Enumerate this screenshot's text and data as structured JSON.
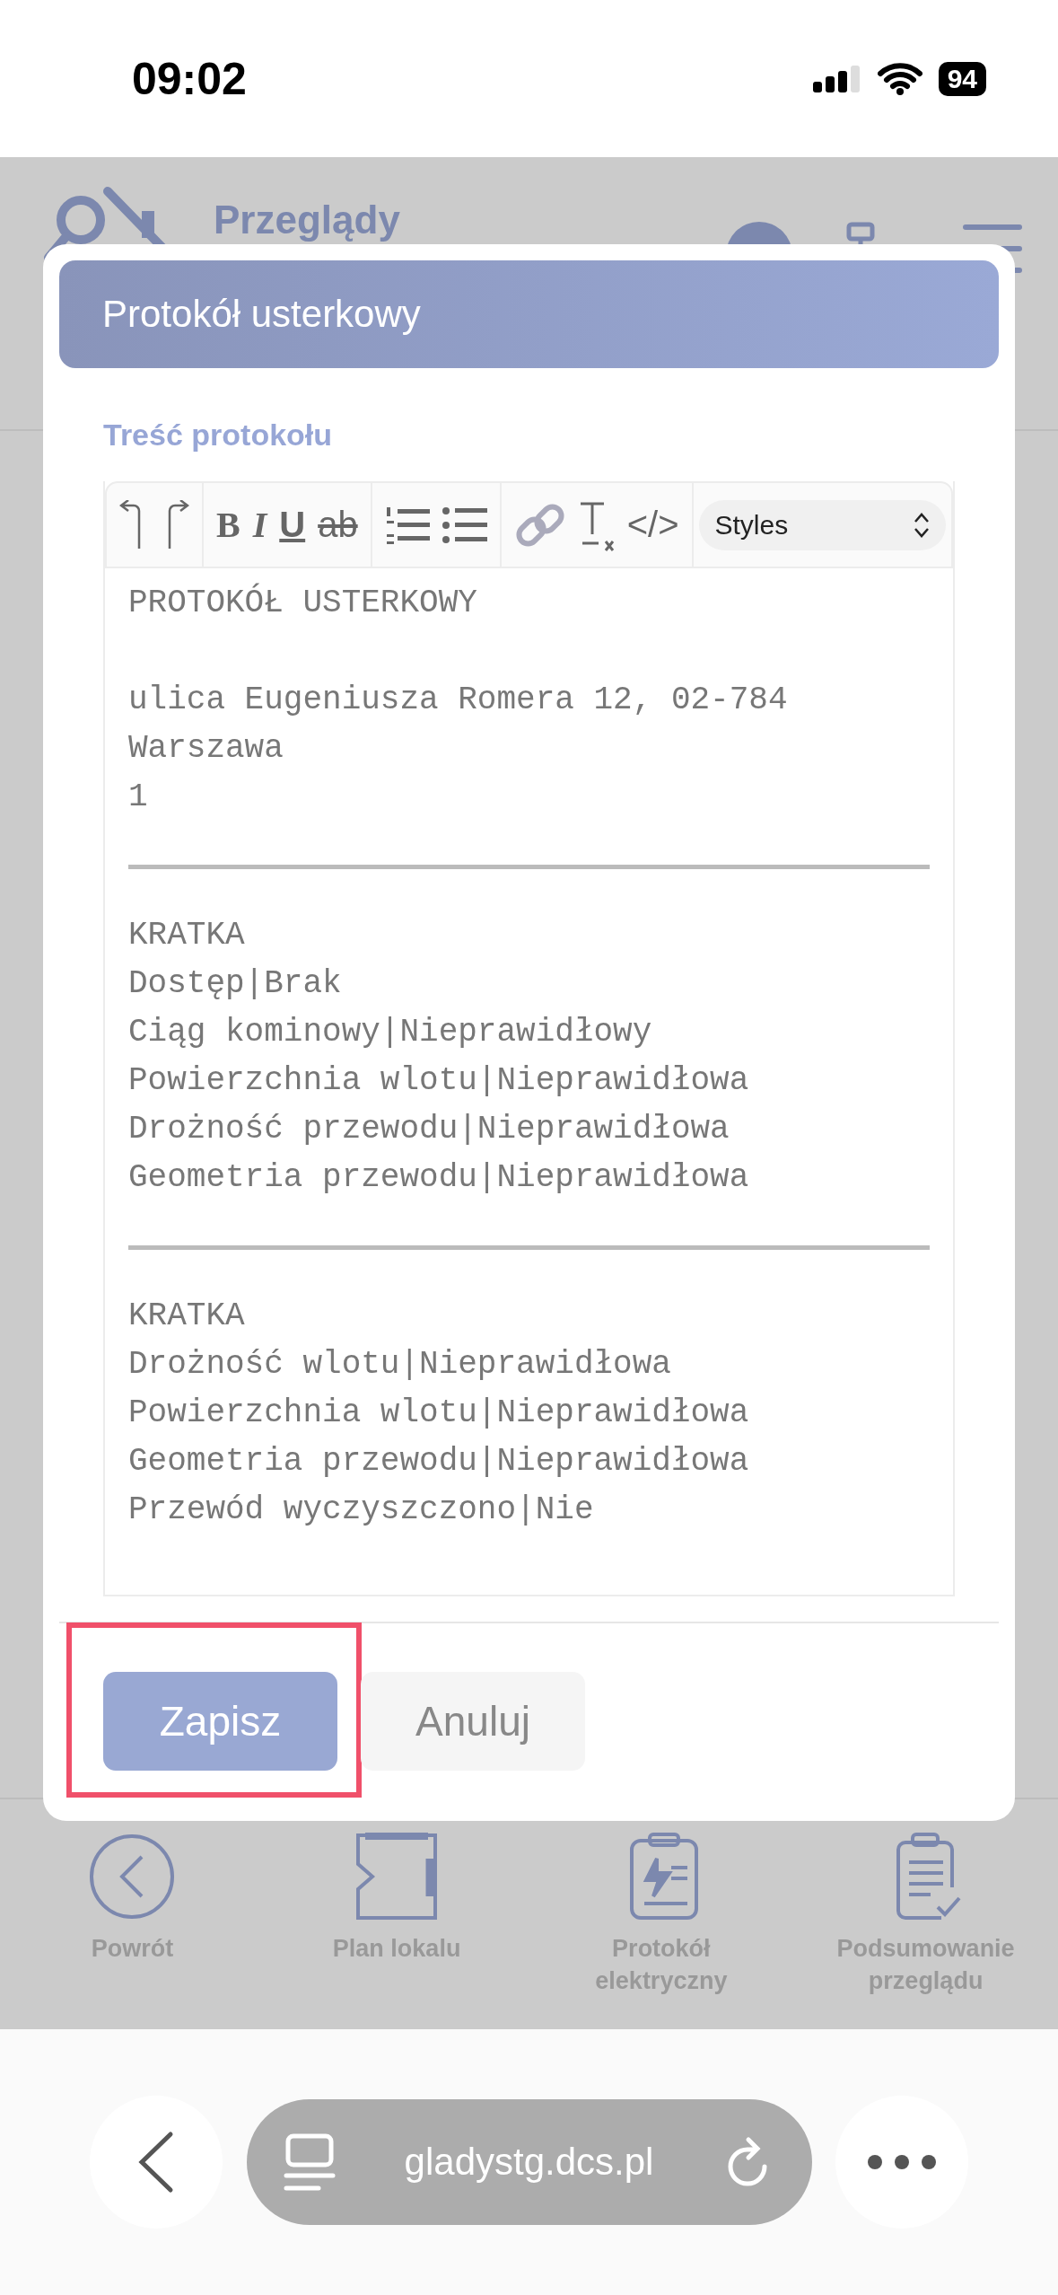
{
  "status_bar": {
    "time": "09:02",
    "battery": "94"
  },
  "app_header": {
    "brand": "Przeglądy"
  },
  "dialog": {
    "title": "Protokół usterkowy",
    "field_label": "Treść protokołu",
    "toolbar": [
      [
        {
          "kind": "undo"
        },
        {
          "kind": "redo"
        }
      ],
      [
        {
          "kind": "bold",
          "label": "B"
        },
        {
          "kind": "italic",
          "label": "I"
        },
        {
          "kind": "underline",
          "label": "U"
        },
        {
          "kind": "strike",
          "label": "ab"
        }
      ],
      [
        {
          "kind": "ordered-list"
        },
        {
          "kind": "bullet-list"
        }
      ],
      [
        {
          "kind": "link"
        },
        {
          "kind": "clear-format"
        },
        {
          "kind": "code",
          "label": "</>"
        }
      ]
    ],
    "styles_select": "Styles",
    "content": [
      {
        "kind": "line",
        "text": "PROTOKÓŁ USTERKOWY"
      },
      {
        "kind": "blank"
      },
      {
        "kind": "line",
        "text": "ulica Eugeniusza Romera 12, 02-784 Warszawa"
      },
      {
        "kind": "line",
        "text": "1"
      },
      {
        "kind": "rule"
      },
      {
        "kind": "line",
        "text": "KRATKA"
      },
      {
        "kind": "line",
        "text": "Dostęp|Brak"
      },
      {
        "kind": "line",
        "text": "Ciąg kominowy|Nieprawidłowy"
      },
      {
        "kind": "line",
        "text": "Powierzchnia wlotu|Nieprawidłowa"
      },
      {
        "kind": "line",
        "text": "Drożność przewodu|Nieprawidłowa"
      },
      {
        "kind": "line",
        "text": "Geometria przewodu|Nieprawidłowa"
      },
      {
        "kind": "rule"
      },
      {
        "kind": "line",
        "text": "KRATKA"
      },
      {
        "kind": "line",
        "text": "Drożność wlotu|Nieprawidłowa"
      },
      {
        "kind": "line",
        "text": "Powierzchnia wlotu|Nieprawidłowa"
      },
      {
        "kind": "line",
        "text": "Geometria przewodu|Nieprawidłowa"
      },
      {
        "kind": "line",
        "text": "Przewód wyczyszczono|Nie"
      }
    ],
    "buttons": [
      {
        "label": "Zapisz",
        "kind": "primary",
        "highlighted": true
      },
      {
        "label": "Anuluj",
        "kind": "secondary",
        "highlighted": false
      }
    ]
  },
  "bottom_nav": [
    {
      "kind": "back",
      "label": "Powrót"
    },
    {
      "kind": "plan",
      "label": "Plan lokalu"
    },
    {
      "kind": "electric",
      "label": "Protokół elektryczny"
    },
    {
      "kind": "summary",
      "label": "Podsumowanie przeglądu"
    }
  ],
  "browser": {
    "url": "gladystg.dcs.pl"
  }
}
